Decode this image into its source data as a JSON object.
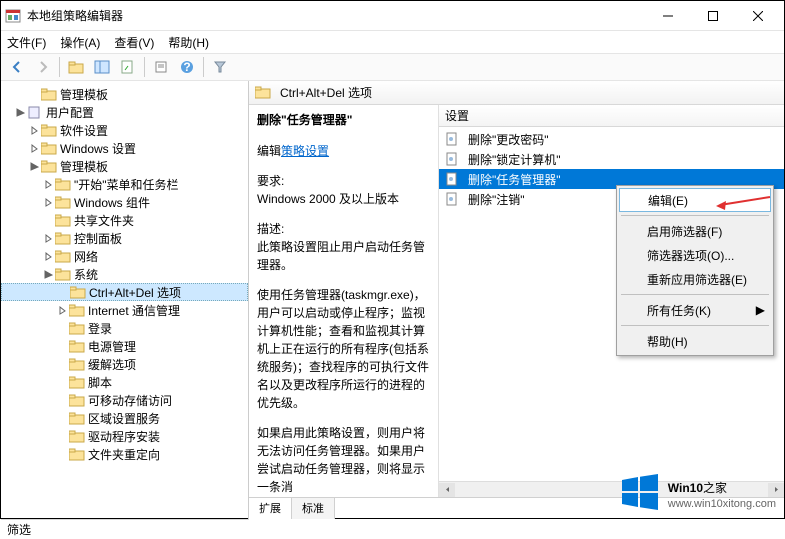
{
  "window": {
    "title": "本地组策略编辑器"
  },
  "menu": {
    "file": "文件(F)",
    "action": "操作(A)",
    "view": "查看(V)",
    "help": "帮助(H)"
  },
  "tree": {
    "admin_templates_top": "管理模板",
    "user_config": "用户配置",
    "software_settings": "软件设置",
    "windows_settings": "Windows 设置",
    "admin_templates": "管理模板",
    "start_taskbar": "\"开始\"菜单和任务栏",
    "windows_components": "Windows 组件",
    "shared_folders": "共享文件夹",
    "control_panel": "控制面板",
    "network": "网络",
    "system": "系统",
    "ctrl_alt_del": "Ctrl+Alt+Del 选项",
    "internet_comm": "Internet 通信管理",
    "logon": "登录",
    "power_mgmt": "电源管理",
    "mitigation_options": "缓解选项",
    "scripts": "脚本",
    "removable_storage": "可移动存储访问",
    "locale_services": "区域设置服务",
    "driver_install": "驱动程序安装",
    "folder_redirect": "文件夹重定向"
  },
  "content": {
    "header": "Ctrl+Alt+Del 选项",
    "detail_title": "删除\"任务管理器\"",
    "edit_label": "编辑",
    "policy_link": "策略设置",
    "req_label": "要求:",
    "req_value": "Windows 2000 及以上版本",
    "desc_label": "描述:",
    "desc1": "此策略设置阻止用户启动任务管理器。",
    "desc2": "使用任务管理器(taskmgr.exe)，用户可以启动或停止程序；监视计算机性能；查看和监视其计算机上正在运行的所有程序(包括系统服务)；查找程序的可执行文件名以及更改程序所运行的进程的优先级。",
    "desc3": "如果启用此策略设置，则用户将无法访问任务管理器。如果用户尝试启动任务管理器，则将显示一条消",
    "list_header": "设置",
    "settings": [
      "删除\"更改密码\"",
      "删除\"锁定计算机\"",
      "删除\"任务管理器\"",
      "删除\"注销\""
    ],
    "tab_ext": "扩展",
    "tab_std": "标准"
  },
  "context": {
    "edit": "编辑(E)",
    "filter_on": "启用筛选器(F)",
    "filter_opts": "筛选器选项(O)...",
    "reapply": "重新应用筛选器(E)",
    "all_tasks": "所有任务(K)",
    "help": "帮助(H)"
  },
  "status": {
    "text": "筛选"
  },
  "watermark": {
    "brand_a": "Win10",
    "brand_b": "之家",
    "url": "www.win10xitong.com"
  }
}
